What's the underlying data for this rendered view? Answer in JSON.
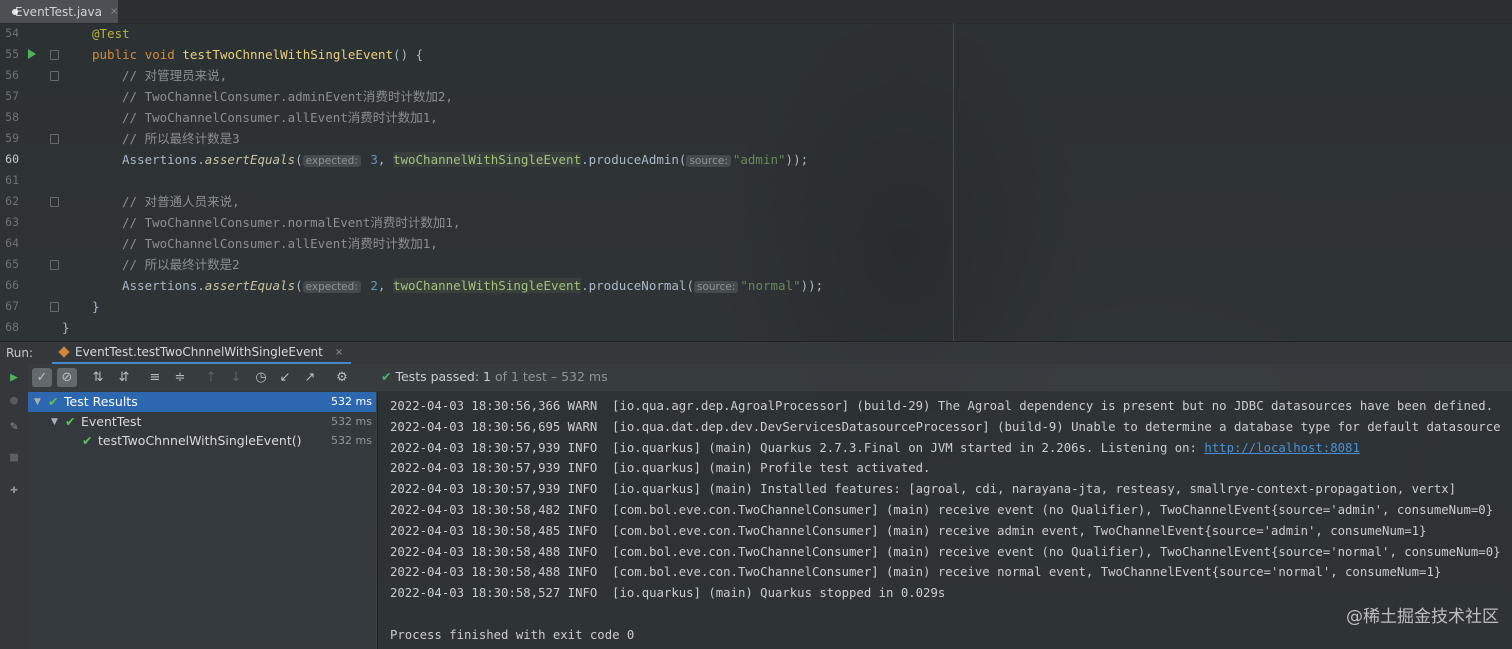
{
  "editor_tab": {
    "label": "EventTest.java",
    "close": "×"
  },
  "editor": {
    "lines": [
      {
        "n": "54",
        "parts": [
          [
            "ann",
            "@Test"
          ]
        ],
        "indent": 0
      },
      {
        "n": "55",
        "parts": [
          [
            "kw",
            "public "
          ],
          [
            "kw",
            "void "
          ],
          [
            "fn",
            "testTwoChnnelWithSingleEvent"
          ],
          [
            "p",
            "() {"
          ]
        ],
        "indent": 0,
        "run": true
      },
      {
        "n": "56",
        "parts": [
          [
            "cm",
            "// 对管理员来说,"
          ]
        ],
        "indent": 1
      },
      {
        "n": "57",
        "parts": [
          [
            "cm",
            "// TwoChannelConsumer.adminEvent消费时计数加2,"
          ]
        ],
        "indent": 1
      },
      {
        "n": "58",
        "parts": [
          [
            "cm",
            "// TwoChannelConsumer.allEvent消费时计数加1,"
          ]
        ],
        "indent": 1
      },
      {
        "n": "59",
        "parts": [
          [
            "cm",
            "// 所以最终计数是3"
          ]
        ],
        "indent": 1
      },
      {
        "n": "60",
        "parts": [
          [
            "p",
            "Assertions."
          ],
          [
            "it",
            "assertEquals"
          ],
          [
            "p",
            "("
          ],
          [
            "hint",
            "expected:"
          ],
          [
            "num",
            " 3"
          ],
          [
            "p",
            ", "
          ],
          [
            "field",
            "twoChannelWithSingleEvent"
          ],
          [
            "p",
            ".produceAdmin("
          ],
          [
            "hint",
            "source:"
          ],
          [
            "str",
            "\"admin\""
          ],
          [
            "p",
            "));"
          ]
        ],
        "indent": 1,
        "current": true
      },
      {
        "n": "61",
        "parts": [],
        "indent": 0
      },
      {
        "n": "62",
        "parts": [
          [
            "cm",
            "// 对普通人员来说,"
          ]
        ],
        "indent": 1
      },
      {
        "n": "63",
        "parts": [
          [
            "cm",
            "// TwoChannelConsumer.normalEvent消费时计数加1,"
          ]
        ],
        "indent": 1
      },
      {
        "n": "64",
        "parts": [
          [
            "cm",
            "// TwoChannelConsumer.allEvent消费时计数加1,"
          ]
        ],
        "indent": 1
      },
      {
        "n": "65",
        "parts": [
          [
            "cm",
            "// 所以最终计数是2"
          ]
        ],
        "indent": 1
      },
      {
        "n": "66",
        "parts": [
          [
            "p",
            "Assertions."
          ],
          [
            "it",
            "assertEquals"
          ],
          [
            "p",
            "("
          ],
          [
            "hint",
            "expected:"
          ],
          [
            "num",
            " 2"
          ],
          [
            "p",
            ", "
          ],
          [
            "field",
            "twoChannelWithSingleEvent"
          ],
          [
            "p",
            ".produceNormal("
          ],
          [
            "hint",
            "source:"
          ],
          [
            "str",
            "\"normal\""
          ],
          [
            "p",
            "));"
          ]
        ],
        "indent": 1
      },
      {
        "n": "67",
        "parts": [
          [
            "p",
            "}"
          ]
        ],
        "indent": 0
      },
      {
        "n": "68",
        "parts": [
          [
            "p",
            "}"
          ]
        ],
        "indent": -1
      }
    ]
  },
  "run_bar": {
    "label": "Run:",
    "tab_label": "EventTest.testTwoChnnelWithSingleEvent",
    "close": "×"
  },
  "toolbar": {
    "status_check": "✔",
    "status_main": "Tests passed: 1",
    "status_rest": " of 1 test – 532 ms"
  },
  "tree": {
    "nodes": [
      {
        "label": "Test Results",
        "time": "532 ms",
        "level": 0,
        "selected": true
      },
      {
        "label": "EventTest",
        "time": "532 ms",
        "level": 1,
        "selected": false
      },
      {
        "label": "testTwoChnnelWithSingleEvent()",
        "time": "532 ms",
        "level": 2,
        "selected": false
      }
    ]
  },
  "console": {
    "lines": [
      "2022-04-03 18:30:56,366 WARN  [io.qua.agr.dep.AgroalProcessor] (build-29) The Agroal dependency is present but no JDBC datasources have been defined.",
      "2022-04-03 18:30:56,695 WARN  [io.qua.dat.dep.dev.DevServicesDatasourceProcessor] (build-9) Unable to determine a database type for default datasource",
      "2022-04-03 18:30:57,939 INFO  [io.quarkus] (main) Quarkus 2.7.3.Final on JVM started in 2.206s. Listening on: ",
      "2022-04-03 18:30:57,939 INFO  [io.quarkus] (main) Profile test activated.",
      "2022-04-03 18:30:57,939 INFO  [io.quarkus] (main) Installed features: [agroal, cdi, narayana-jta, resteasy, smallrye-context-propagation, vertx]",
      "2022-04-03 18:30:58,482 INFO  [com.bol.eve.con.TwoChannelConsumer] (main) receive event (no Qualifier), TwoChannelEvent{source='admin', consumeNum=0}",
      "2022-04-03 18:30:58,485 INFO  [com.bol.eve.con.TwoChannelConsumer] (main) receive admin event, TwoChannelEvent{source='admin', consumeNum=1}",
      "2022-04-03 18:30:58,488 INFO  [com.bol.eve.con.TwoChannelConsumer] (main) receive event (no Qualifier), TwoChannelEvent{source='normal', consumeNum=0}",
      "2022-04-03 18:30:58,488 INFO  [com.bol.eve.con.TwoChannelConsumer] (main) receive normal event, TwoChannelEvent{source='normal', consumeNum=1}",
      "2022-04-03 18:30:58,527 INFO  [io.quarkus] (main) Quarkus stopped in 0.029s",
      "",
      "Process finished with exit code 0"
    ],
    "link": "http://localhost:8081"
  },
  "watermark": "@稀土掘金技术社区",
  "colors": {
    "accent": "#2d67b0",
    "success": "#4fb35d",
    "link": "#4a8fd6"
  }
}
